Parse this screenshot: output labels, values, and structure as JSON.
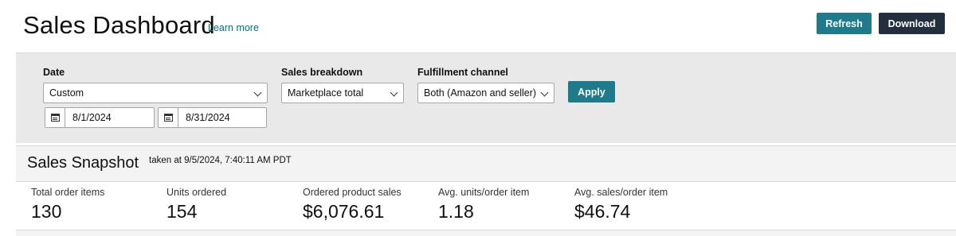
{
  "header": {
    "title": "Sales Dashboard",
    "learn_more": "Learn more",
    "refresh_label": "Refresh",
    "download_label": "Download"
  },
  "filters": {
    "date": {
      "label": "Date",
      "selected": "Custom",
      "start": "8/1/2024",
      "end": "8/31/2024"
    },
    "sales_breakdown": {
      "label": "Sales breakdown",
      "selected": "Marketplace total"
    },
    "fulfillment_channel": {
      "label": "Fulfillment channel",
      "selected": "Both (Amazon and seller)"
    },
    "apply_label": "Apply"
  },
  "snapshot": {
    "title": "Sales Snapshot",
    "taken": "taken at 9/5/2024, 7:40:11 AM PDT",
    "metrics": [
      {
        "label": "Total order items",
        "value": "130"
      },
      {
        "label": "Units ordered",
        "value": "154"
      },
      {
        "label": "Ordered product sales",
        "value": "$6,076.61"
      },
      {
        "label": "Avg. units/order item",
        "value": "1.18"
      },
      {
        "label": "Avg. sales/order item",
        "value": "$46.74"
      }
    ]
  },
  "colors": {
    "accent": "#1f7a8c",
    "dark_button": "#232f3e",
    "link": "#007185",
    "filter_bg": "#e9e9e9"
  },
  "icons": [
    "calendar-icon",
    "chevron-down-icon"
  ]
}
